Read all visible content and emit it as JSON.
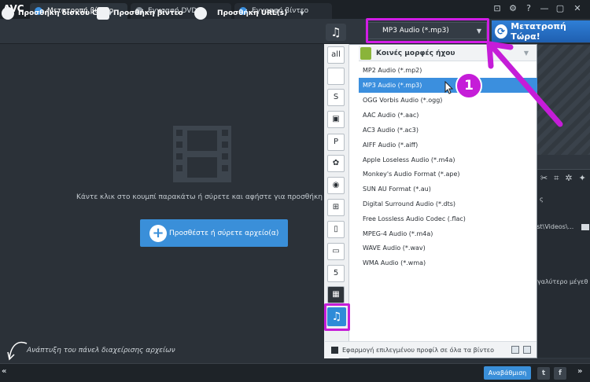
{
  "app": {
    "logo": "AVC"
  },
  "tabs": [
    {
      "label": "Μετατροπή βίντεο",
      "active": true
    },
    {
      "label": "Εγγραφή DVD",
      "active": false
    },
    {
      "label": "Εγγραφή βίντεο",
      "active": false
    }
  ],
  "window_controls": [
    "⊡",
    "⚙",
    "?",
    "—",
    "▢",
    "✕"
  ],
  "toolbar": {
    "add_disc": "Προσθήκη δίσκου CD",
    "add_video": "Προσθήκη βίντεο",
    "add_url": "Προσθήκη URL(s)",
    "profile_value": "MP3 Audio (*.mp3)",
    "convert": "Μετατροπή Τώρα!"
  },
  "main": {
    "hint": "Κάντε κλικ στο κουμπί παρακάτω ή σύρετε και αφήστε για προσθήκη",
    "add_button": "Προσθέστε ή σύρετε αρχείο(α)",
    "files_panel_hint": "Ανάπτυξη του πάνελ διαχείρισης αρχείων"
  },
  "dropdown": {
    "group_title": "Κοινές μορφές ήχου",
    "formats": [
      "MP2 Audio (*.mp2)",
      "MP3 Audio (*.mp3)",
      "OGG Vorbis Audio (*.ogg)",
      "AAC Audio (*.aac)",
      "AC3 Audio (*.ac3)",
      "AIFF Audio (*.aiff)",
      "Apple Loseless Audio (*.m4a)",
      "Monkey's Audio Format (*.ape)",
      "SUN AU Format (*.au)",
      "Digital Surround Audio (*.dts)",
      "Free Lossless Audio Codec (.flac)",
      "MPEG-4 Audio (*.m4a)",
      "WAVE Audio (*.wav)",
      "WMA Audio (*.wma)"
    ],
    "selected_index": 1,
    "apply_label": "Εφαρμογή επιλεγμένου προφίλ σε όλα τα βίντεο",
    "categories": [
      "all-icon",
      "apple-icon",
      "android-skype-icon",
      "android-icon",
      "playstation-icon",
      "huawei-icon",
      "lg-icon",
      "windows-icon",
      "mobile-icon",
      "tv-icon",
      "html5-icon",
      "film-icon",
      "music-icon"
    ]
  },
  "right_panel": {
    "label1": "ς",
    "path": "tist\\Videos\\...",
    "size_text": "γαλύτερο μέγεθ"
  },
  "bottom": {
    "upgrade": "Αναβάθμιση",
    "expand": "«",
    "collapse": "»",
    "social": [
      "t",
      "f"
    ]
  },
  "annotation": {
    "step": "1"
  },
  "colors": {
    "accent": "#3b8fde",
    "highlight": "#c51dd8",
    "dark_bg": "#2b3138"
  }
}
